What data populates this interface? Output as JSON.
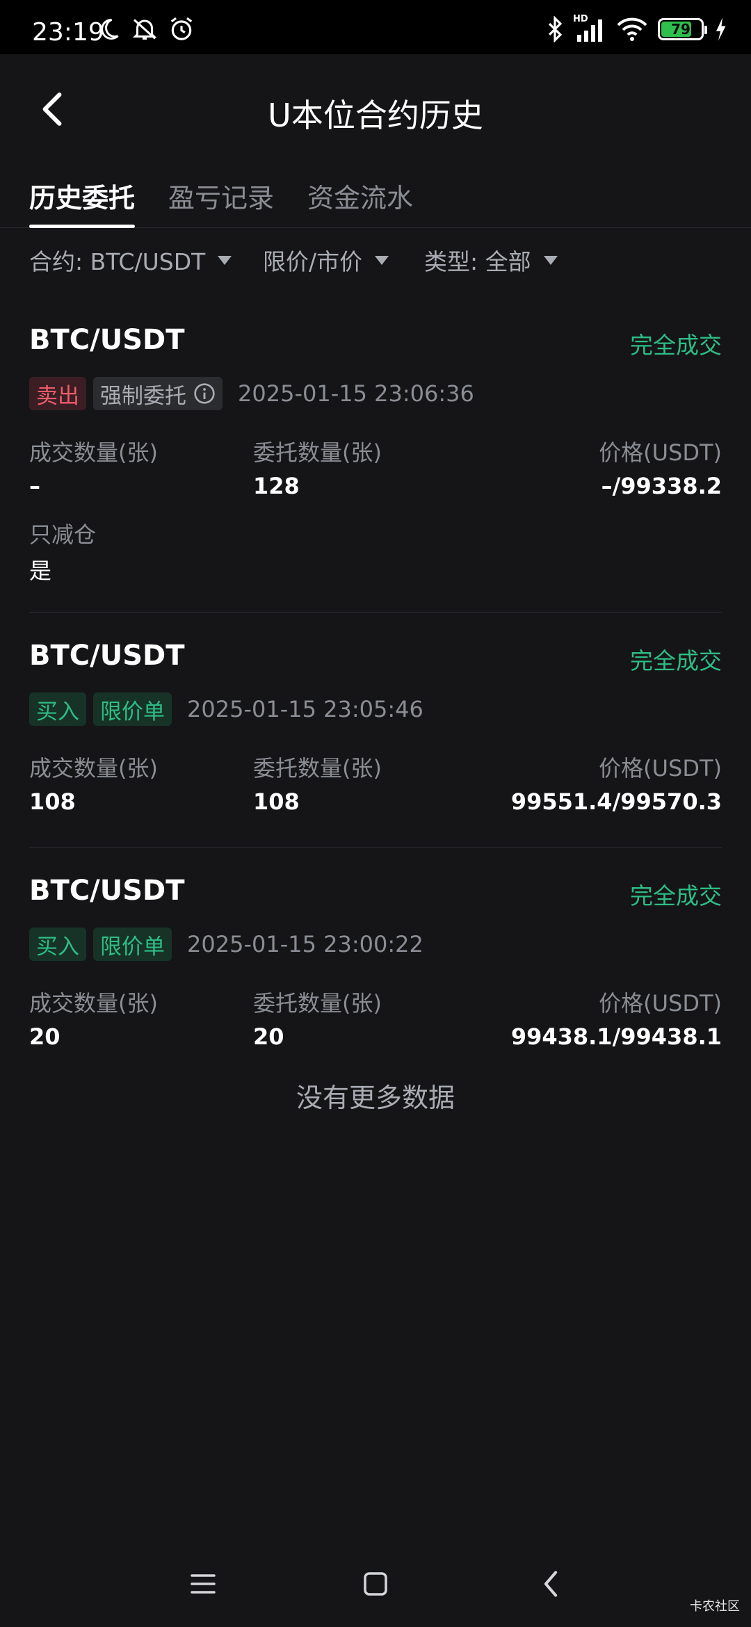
{
  "status_bar": {
    "time": "23:19",
    "battery": "79",
    "battery_level": 0.79,
    "hd_label": "HD",
    "icons": [
      "moon-icon",
      "bell-off-icon",
      "alarm-icon",
      "bluetooth-icon",
      "signal-icon",
      "wifi-icon",
      "battery-icon",
      "charging-icon"
    ]
  },
  "header": {
    "title": "U本位合约历史",
    "back_icon": "chevron-left-icon"
  },
  "tabs": [
    {
      "label": "历史委托",
      "active": true
    },
    {
      "label": "盈亏记录",
      "active": false
    },
    {
      "label": "资金流水",
      "active": false
    }
  ],
  "filters": {
    "contract": "合约: BTC/USDT",
    "order_type": "限价/市价",
    "kind": "类型: 全部"
  },
  "colors": {
    "background": "#151517",
    "buy_green": "#2ebd85",
    "sell_red": "#f05c6a"
  },
  "orders": [
    {
      "pair": "BTC/USDT",
      "status": "完全成交",
      "side": "卖出",
      "type": "强制委托",
      "time": "2025-01-15 23:06:36",
      "filled_label": "成交数量(张)",
      "filled": "–",
      "amount_label": "委托数量(张)",
      "amount": "128",
      "price_label": "价格(USDT)",
      "price": "–/99338.2",
      "reduce_label": "只减仓",
      "reduce": "是"
    },
    {
      "pair": "BTC/USDT",
      "status": "完全成交",
      "side": "买入",
      "type": "限价单",
      "time": "2025-01-15 23:05:46",
      "filled_label": "成交数量(张)",
      "filled": "108",
      "amount_label": "委托数量(张)",
      "amount": "108",
      "price_label": "价格(USDT)",
      "price": "99551.4/99570.3"
    },
    {
      "pair": "BTC/USDT",
      "status": "完全成交",
      "side": "买入",
      "type": "限价单",
      "time": "2025-01-15 23:00:22",
      "filled_label": "成交数量(张)",
      "filled": "20",
      "amount_label": "委托数量(张)",
      "amount": "20",
      "price_label": "价格(USDT)",
      "price": "99438.1/99438.1"
    }
  ],
  "footer": {
    "no_more": "没有更多数据"
  },
  "watermark": "卡农社区"
}
